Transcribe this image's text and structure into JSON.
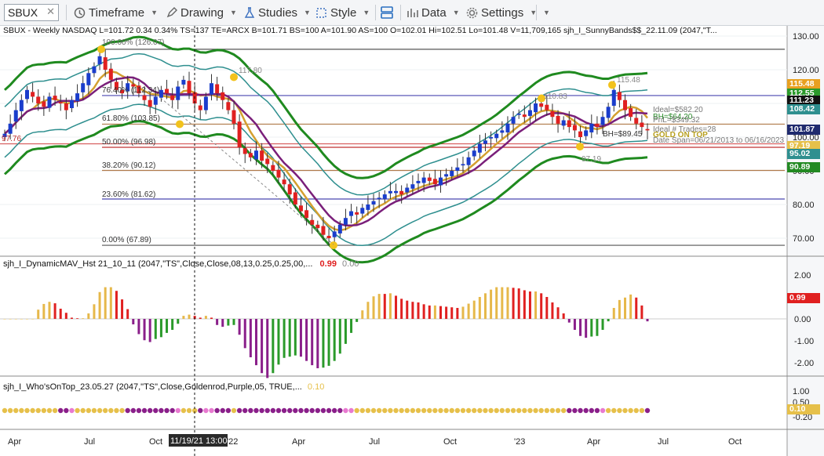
{
  "toolbar": {
    "symbol": "SBUX",
    "clear": "✕",
    "timeframe": "Timeframe",
    "drawing": "Drawing",
    "studies": "Studies",
    "style": "Style",
    "data": "Data",
    "settings": "Settings"
  },
  "header": "SBUX - Weekly  NASDAQ  L=101.72  0.34  0.34%  TS=137  TE=ARCX  B=101.71  BS=100  A=101.90  AS=100  O=102.01  Hi=102.51  Lo=101.48  V=11,709,165  sjh_I_SunnyBands$$_22.11.09 (2047,\"T...",
  "fib_labels": [
    "100.00% (126.07)",
    "76.40% (112.34)",
    "61.80% (103.85)",
    "50.00% (96.98)",
    "38.20% (90.12)",
    "23.60% (81.62)",
    "0.00% (67.89)"
  ],
  "chart_labels": {
    "high1": "117.80",
    "high2": "110.83",
    "high3": "115.48",
    "low1": "97.19",
    "low_left": "97.76",
    "ideal": "Ideal=$582.20",
    "bh": "BH=$64.20",
    "pnl": "PnL=$349.32",
    "trades": "Ideal # Trades=28",
    "bh2": "BH=$89.45",
    "gold": "GOLD ON TOP",
    "span": "Date Span=06/21/2013 to 06/16/2023",
    "cursor_date": "11/19/21 13:00"
  },
  "price_axis": [
    "130.00",
    "120.00",
    "110.00",
    "100.00",
    "90.00",
    "80.00",
    "70.00"
  ],
  "price_tags": [
    {
      "value": "115.48",
      "color": "#e8a020"
    },
    {
      "value": "112.55",
      "color": "#2b9a2b"
    },
    {
      "value": "111.23",
      "color": "#111111"
    },
    {
      "value": "108.42",
      "color": "#2e8f8f"
    },
    {
      "value": "101.87",
      "color": "#1f2a6e"
    },
    {
      "value": "97.19",
      "color": "#e6c04a"
    },
    {
      "value": "95.02",
      "color": "#2e8f8f"
    },
    {
      "value": "90.89",
      "color": "#238a23"
    }
  ],
  "pane2": {
    "title": "sjh_I_DynamicMAV_Hst 21_10_11 (2047,\"TS\",Close,Close,08,13,0.25,0.25,00,...",
    "value1": "0.99",
    "value2": "0.00",
    "axis": [
      "2.00",
      "1.00",
      "0.00",
      "-1.00",
      "-2.00"
    ],
    "tag": "0.99"
  },
  "pane3": {
    "title": "sjh_I_Who'sOnTop_23.05.27 (2047,\"TS\",Close,Goldenrod,Purple,05,  TRUE,...",
    "value": "0.10",
    "axis": [
      "1.00",
      "0.50",
      "-0.20"
    ],
    "tag": "0.10"
  },
  "time_axis": [
    "Apr",
    "Jul",
    "Oct",
    "'22",
    "Apr",
    "Jul",
    "Oct",
    "'23",
    "Apr",
    "Jul",
    "Oct"
  ],
  "colors": {
    "up": "#1a3dcc",
    "down": "#e02020",
    "fib_purple": "#5a4fb0",
    "fib_brown": "#b07a4a"
  },
  "chart_data": {
    "type": "candlestick",
    "title": "SBUX - Weekly",
    "ylim": [
      64,
      133
    ],
    "close": [
      101,
      104,
      108,
      111,
      114,
      112,
      110,
      109,
      112,
      111,
      110,
      108,
      111,
      113,
      116,
      119,
      121,
      124,
      120,
      117,
      114,
      113,
      116,
      115,
      113,
      111,
      109,
      112,
      114,
      113,
      111,
      115,
      117,
      113,
      110,
      108,
      112,
      116,
      113,
      111,
      108,
      104,
      97,
      95,
      94,
      96,
      93,
      92,
      90,
      88,
      86,
      83,
      80,
      78,
      76,
      74,
      73,
      71,
      70,
      72,
      74,
      76,
      78,
      77,
      79,
      80,
      81,
      82,
      83,
      84,
      84,
      83,
      85,
      86,
      87,
      88,
      87,
      86,
      88,
      89,
      90,
      91,
      92,
      94,
      96,
      98,
      99,
      100,
      101,
      102,
      104,
      106,
      107,
      106,
      108,
      110,
      109,
      108,
      106,
      104,
      105,
      103,
      102,
      100,
      102,
      104,
      103,
      106,
      109,
      114,
      111,
      108,
      106,
      104,
      103,
      102
    ]
  }
}
